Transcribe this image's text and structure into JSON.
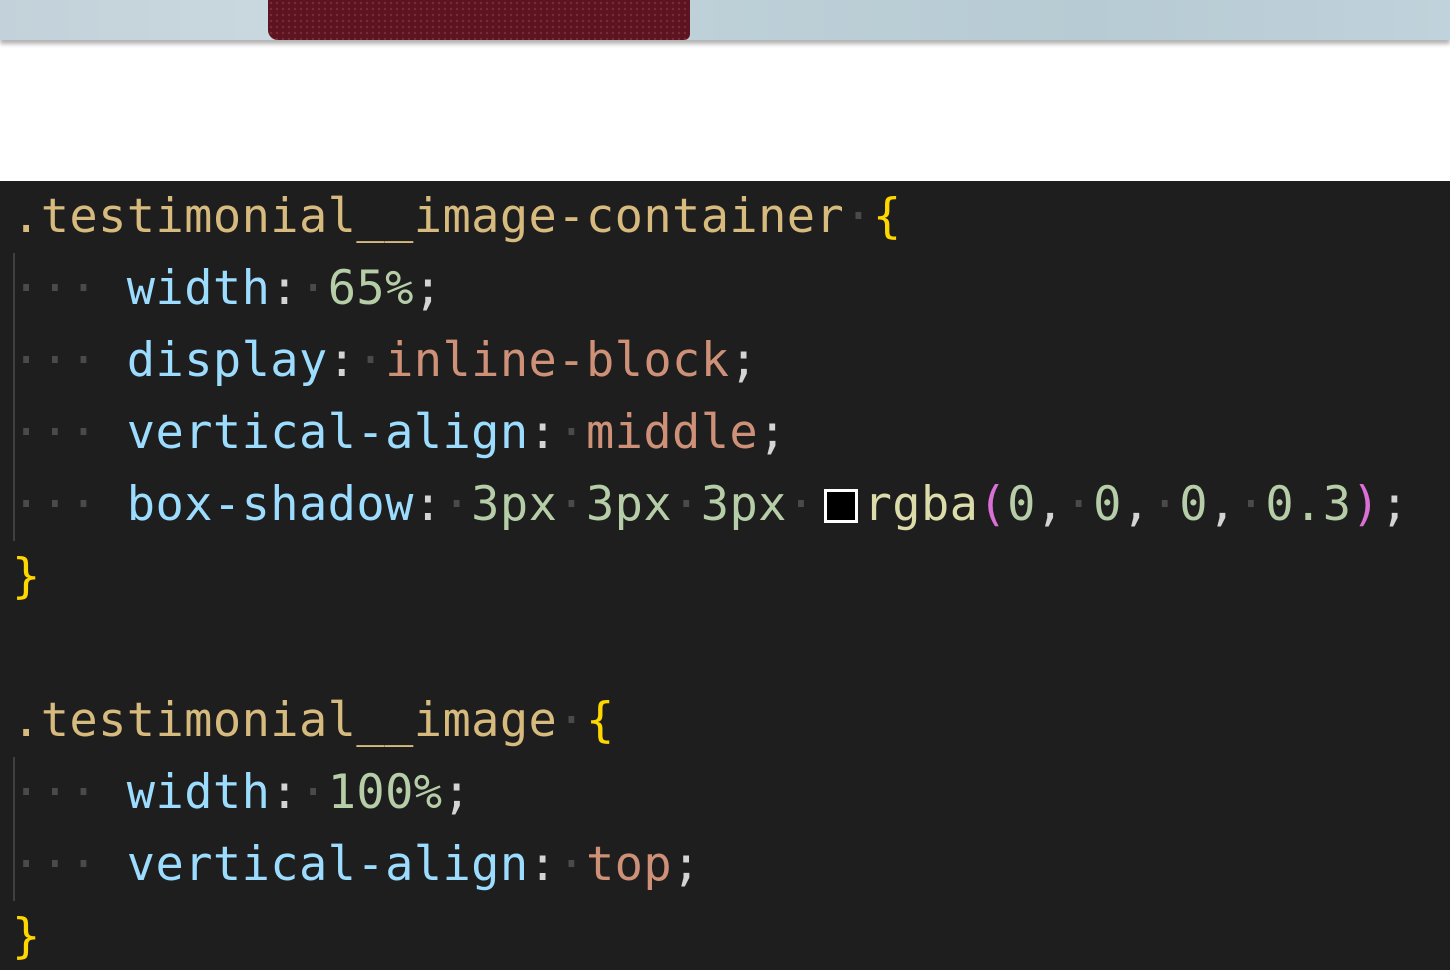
{
  "colors": {
    "editor_background": "#1e1e1e",
    "selector": "#d7ba7d",
    "brace": "#ffd700",
    "property": "#9cdcfe",
    "number": "#b5cea8",
    "keyword_value": "#ce9178",
    "function": "#dcdcaa",
    "paren": "#da70d6",
    "whitespace_dots": "#4a4a4a",
    "swatch_color": "#000000"
  },
  "preview": {
    "description_icon": "photo-strip"
  },
  "code": {
    "rule1": {
      "selector": ".testimonial__image-container",
      "open_brace": "{",
      "close_brace": "}",
      "decl1": {
        "prop": "width",
        "value": "65%"
      },
      "decl2": {
        "prop": "display",
        "value": "inline-block"
      },
      "decl3": {
        "prop": "vertical-align",
        "value": "middle"
      },
      "decl4": {
        "prop": "box-shadow",
        "value_a": "3px",
        "value_b": "3px",
        "value_c": "3px",
        "fn": "rgba",
        "paren_open": "(",
        "args": [
          "0",
          "0",
          "0",
          "0.3"
        ],
        "paren_close": ")"
      }
    },
    "rule2": {
      "selector": ".testimonial__image",
      "open_brace": "{",
      "close_brace": "}",
      "decl1": {
        "prop": "width",
        "value": "100%"
      },
      "decl2": {
        "prop": "vertical-align",
        "value": "top"
      }
    },
    "colon": ":",
    "semicolon": ";",
    "comma": ",",
    "dot": "·",
    "indent_dots": "···"
  }
}
